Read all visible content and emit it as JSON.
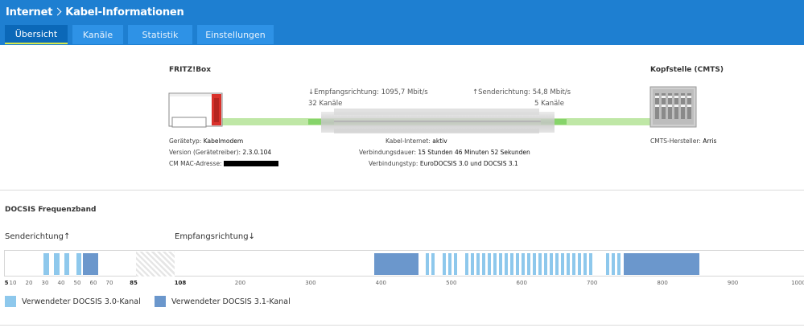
{
  "header": {
    "crumb_root": "Internet",
    "crumb_page": "Kabel-Informationen",
    "tabs": [
      {
        "label": "Übersicht",
        "active": true
      },
      {
        "label": "Kanäle",
        "active": false
      },
      {
        "label": "Statistik",
        "active": false
      },
      {
        "label": "Einstellungen",
        "active": false
      }
    ]
  },
  "fritzbox": {
    "title": "FRITZ!Box",
    "device_type_label": "Gerätetyp:",
    "device_type_value": "Kabelmodem",
    "version_label": "Version (Gerätetreiber):",
    "version_value": "2.3.0.104",
    "mac_label": "CM MAC-Adresse:"
  },
  "link": {
    "down_rate_label": "↓Empfangsrichtung:",
    "down_rate_value": "1095,7 Mbit/s",
    "down_channels": "32 Kanäle",
    "up_rate_label": "↑Senderichtung:",
    "up_rate_value": "54,8 Mbit/s",
    "up_channels": "5 Kanäle",
    "cable_internet_label": "Kabel-Internet:",
    "cable_internet_value": "aktiv",
    "duration_label": "Verbindungsdauer:",
    "duration_value": "15 Stunden 46 Minuten 52 Sekunden",
    "conn_type_label": "Verbindungstyp:",
    "conn_type_value": "EuroDOCSIS 3.0 und DOCSIS 3.1"
  },
  "cmts": {
    "title": "Kopfstelle (CMTS)",
    "vendor_label": "CMTS-Hersteller:",
    "vendor_value": "Arris"
  },
  "docsis": {
    "title": "DOCSIS Frequenzband",
    "up_label": "Senderichtung↑",
    "down_label": "Empfangsrichtung↓",
    "up_ticks": [
      "5",
      "10",
      "20",
      "30",
      "40",
      "50",
      "60",
      "70",
      "85"
    ],
    "down_ticks": [
      "108",
      "200",
      "300",
      "400",
      "500",
      "600",
      "700",
      "800",
      "900",
      "1000"
    ],
    "up_channels_30_mhz": [
      30.8,
      37.2,
      43.6,
      51.0
    ],
    "up_channels_31_mhz": [
      [
        53.5,
        63.0
      ]
    ],
    "down_channels_30_mhz": [
      466.0,
      474.0,
      490.0,
      498.0,
      506.0,
      522.0,
      530.0,
      538.0,
      546.0,
      554.0,
      562.0,
      570.0,
      578.0,
      586.0,
      594.0,
      602.0,
      610.0,
      618.0,
      626.0,
      634.0,
      642.0,
      650.0,
      658.0,
      666.0,
      674.0,
      682.0,
      690.0,
      698.0,
      722.0,
      730.0,
      738.0
    ],
    "down_channels_31_mhz": [
      [
        391.0,
        453.0
      ],
      [
        745.0,
        853.0
      ]
    ],
    "legend_30": "Verwendeter DOCSIS 3.0-Kanal",
    "legend_31": "Verwendeter DOCSIS 3.1-Kanal",
    "colors": {
      "docsis30": "#8ec8ec",
      "docsis31": "#6b97cc"
    }
  }
}
